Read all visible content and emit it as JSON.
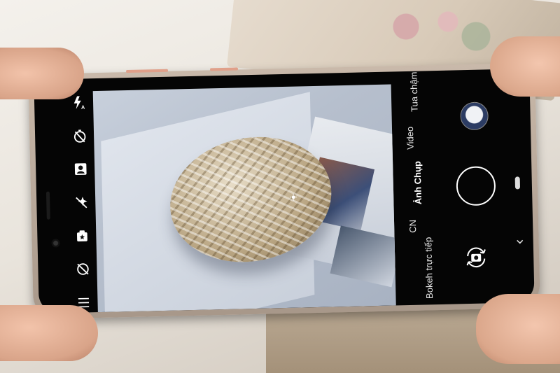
{
  "camera": {
    "left_icons": [
      {
        "name": "flash-auto-icon"
      },
      {
        "name": "timer-off-icon"
      },
      {
        "name": "portrait-icon"
      },
      {
        "name": "beautify-off-icon"
      },
      {
        "name": "sticker-icon"
      },
      {
        "name": "lens-off-icon"
      },
      {
        "name": "menu-icon"
      }
    ],
    "modes": [
      {
        "label": "Tua chậm",
        "active": false
      },
      {
        "label": "Video",
        "active": false
      },
      {
        "label": "Ảnh Chụp",
        "active": true
      },
      {
        "label": "CN",
        "active": false
      },
      {
        "label": "Bokeh trực tiếp",
        "active": false
      }
    ],
    "right_controls": {
      "thumbnail": "last-photo-thumbnail",
      "shutter": "shutter-button",
      "switch": "switch-camera-icon"
    },
    "colors": {
      "screen": "#050505",
      "text": "#ffffff",
      "phone_frame": "#b8a898"
    }
  }
}
